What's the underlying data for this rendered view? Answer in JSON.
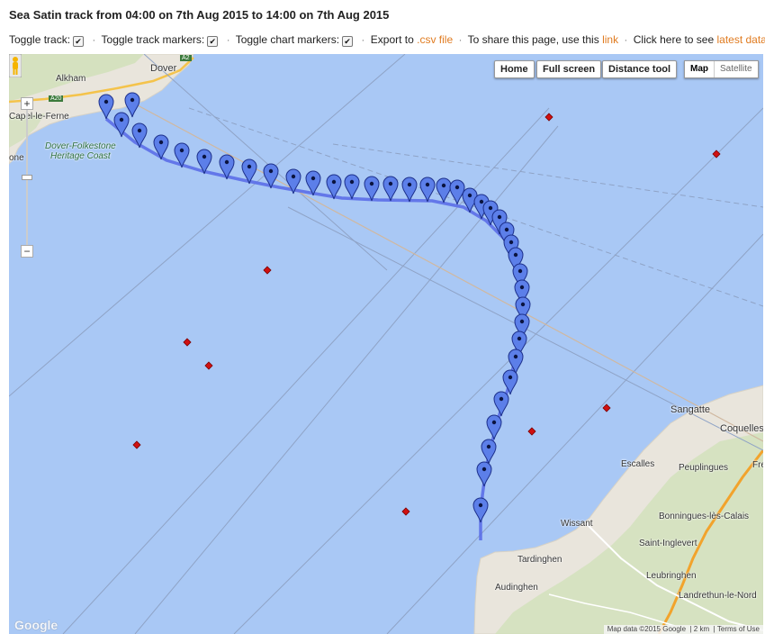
{
  "page": {
    "title": "Sea Satin track from 04:00 on 7th Aug 2015 to 14:00 on 7th Aug 2015"
  },
  "toolbar": {
    "toggle_track": "Toggle track:",
    "toggle_track_markers": "Toggle track markers:",
    "toggle_chart_markers": "Toggle chart markers:",
    "export_prefix": "Export to",
    "export_link": ".csv file",
    "share_text": "To share this page, use this",
    "share_link": "link",
    "latest_text": "Click here to see",
    "latest_link": "latest data",
    "period": ".",
    "checkmark": "✔",
    "separator": "·"
  },
  "map_controls": {
    "home": "Home",
    "full_screen": "Full screen",
    "distance_tool": "Distance tool",
    "map": "Map",
    "satellite": "Satellite",
    "zoom_in": "+",
    "zoom_out": "−"
  },
  "places": {
    "dover": "Dover",
    "alkham": "Alkham",
    "capel": "Capel-le-Ferne",
    "folkestone_coast_1": "Dover-Folkestone",
    "folkestone_coast_2": "Heritage Coast",
    "one": "one",
    "sangatte": "Sangatte",
    "coquelles": "Coquelles",
    "fre": "Fre",
    "escalles": "Escalles",
    "peuplingues": "Peuplingues",
    "wissant": "Wissant",
    "bonningues": "Bonningues-lès-Calais",
    "saint_inglevert": "Saint-Inglevert",
    "tardinghen": "Tardinghen",
    "leubringhen": "Leubringhen",
    "audinghen": "Audinghen",
    "landrethun": "Landrethun-le-Nord",
    "road_a20": "A20",
    "road_a2": "A2",
    "road_a20_2": "A20"
  },
  "attribution": {
    "google": "Google",
    "map_data": "Map data ©2015 Google",
    "scale": "2 km",
    "terms": "Terms of Use"
  },
  "colors": {
    "sea": "#a9c8f5",
    "land": "#e9e5dc",
    "track": "#5b6ee8",
    "marker": "#5c7fe9",
    "chart_marker": "#d01010",
    "link": "#e07b20"
  },
  "map_data": {
    "track_marker_count": 39,
    "chart_marker_count": 10
  }
}
